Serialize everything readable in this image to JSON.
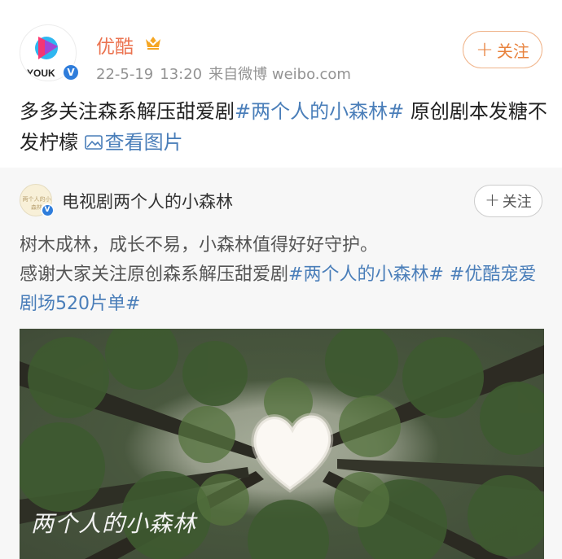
{
  "post": {
    "author": {
      "name": "优酷",
      "avatar_text": "YOUK",
      "vip_badge_icon": "vip-crown-icon",
      "verified": true
    },
    "meta": {
      "date": "22-5-19",
      "time": "13:20",
      "source": "来自微博 weibo.com"
    },
    "follow_label": "关注",
    "text": {
      "part1": "多多关注森系解压甜爱剧",
      "topic": "#两个人的小森林#",
      "part2": " 原创剧本发糖不发柠檬 ",
      "view_pictures": "查看图片"
    }
  },
  "repost": {
    "author": {
      "name": "电视剧两个人的小森林",
      "avatar_text": "两个人的小森林",
      "verified": true
    },
    "follow_label": "关注",
    "text": {
      "line1": "树木成林，成长不易，小森林值得好好守护。",
      "line2_prefix": "感谢大家关注原创森系解压甜爱剧",
      "topic1": "#两个人的小森林#",
      "space": " ",
      "topic2": "#优酷宠爱剧场520片单#"
    },
    "image": {
      "watermark": "两个人的小森林",
      "alt_icon": "forest-canopy-heart-image"
    }
  },
  "colors": {
    "author_orange": "#eb7350",
    "follow_orange": "#e8823d",
    "topic_blue": "#4a7eb9",
    "meta_gray": "#939393",
    "repost_bg": "#f7f7f7"
  }
}
